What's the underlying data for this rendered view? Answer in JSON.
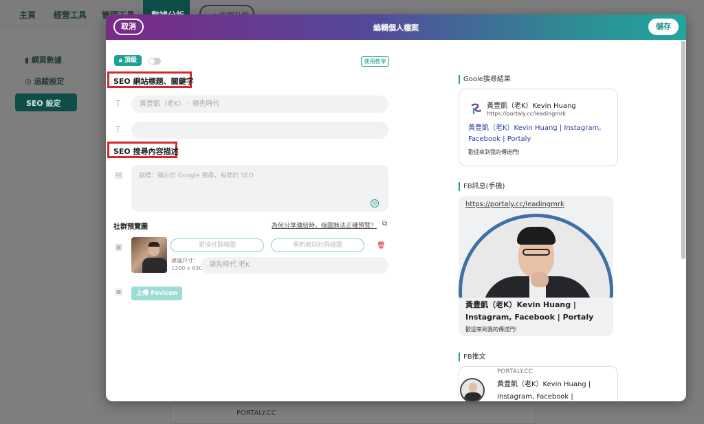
{
  "background": {
    "nav": {
      "items": [
        "主頁",
        "經營工具",
        "管理工具"
      ],
      "active": "數據分析",
      "upgrade": "方案升級"
    },
    "sidebar": {
      "items": [
        "網頁數據",
        "追蹤設定"
      ],
      "active": "SEO 設定"
    },
    "card_domain": "PORTALY.CC"
  },
  "modal": {
    "cancel_label": "取消",
    "title": "編輯個人檔案",
    "save_label": "儲存",
    "tier_badge": "頂級",
    "tutorial_label": "使用教學",
    "seo_title_section": "SEO 網站標題、關鍵字",
    "title_placeholder": "黃豊凱（老K） - 領先時代",
    "keywords_value": "",
    "seo_desc_section": "SEO 搜尋內容描述",
    "desc_placeholder": "副標：顯示於 Google 搜尋，有助於 SEO",
    "social_preview_section": "社群預覽圖",
    "share_help_link": "為何分享連結時，縮圖無法正確預覽？",
    "replace_image_button": "更換社群縮圖",
    "recrop_button": "重新裁切社群縮圖",
    "size_label_1": "建議尺寸：",
    "size_label_2": "1200 x 630",
    "alt_placeholder": "領先時代 老K",
    "upload_favicon_button": "上傳 Favicon",
    "google_preview": {
      "section": "Goole搜尋結果",
      "name": "黃豊凱（老K）Kevin Huang",
      "url": "https://portaly.cc/leadingmrk",
      "link_title": "黃豊凱（老K）Kevin Huang | Instagram, Facebook | Portaly",
      "description": "歡迎來到我的傳送門!"
    },
    "fb_preview": {
      "section": "FB訊息(手機)",
      "url": "https://portaly.cc/leadingmrk",
      "name": "黃豊凱（老K）Kevin Huang | Instagram, Facebook | Portaly",
      "description": "歡迎來到我的傳送門!"
    },
    "twitter_preview": {
      "section": "FB推文",
      "domain": "PORTALY.CC",
      "name": "黃豊凱（老K）Kevin Huang | Instagram, Facebook |"
    }
  },
  "colors": {
    "accent": "#21a095",
    "highlight_box": "#d6282c",
    "header_start": "#7a2a86",
    "header_end": "#20a79b",
    "link": "#2a3f9f"
  }
}
